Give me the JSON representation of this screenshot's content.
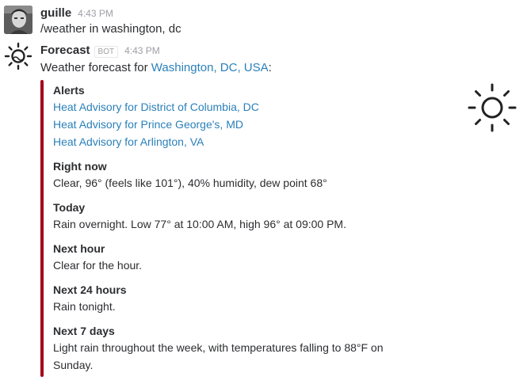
{
  "user_message": {
    "author": "guille",
    "time": "4:43 PM",
    "text": "/weather in washington, dc"
  },
  "bot_message": {
    "author": "Forecast",
    "bot_tag": "BOT",
    "time": "4:43 PM",
    "intro_prefix": "Weather forecast for ",
    "location_link": "Washington, DC, USA",
    "intro_suffix": ":"
  },
  "attachment": {
    "accent_color": "#a3001a",
    "icon": "sun-icon",
    "alerts_title": "Alerts",
    "alerts": [
      "Heat Advisory for District of Columbia, DC",
      "Heat Advisory for Prince George's, MD",
      "Heat Advisory for Arlington, VA"
    ],
    "fields": [
      {
        "title": "Right now",
        "value": "Clear, 96° (feels like 101°), 40% humidity, dew point 68°"
      },
      {
        "title": "Today",
        "value": "Rain overnight. Low 77° at 10:00 AM, high 96° at 09:00 PM."
      },
      {
        "title": "Next hour",
        "value": "Clear for the hour."
      },
      {
        "title": "Next 24 hours",
        "value": "Rain tonight."
      },
      {
        "title": "Next 7 days",
        "value": "Light rain throughout the week, with temperatures falling to 88°F on Sunday."
      }
    ]
  }
}
